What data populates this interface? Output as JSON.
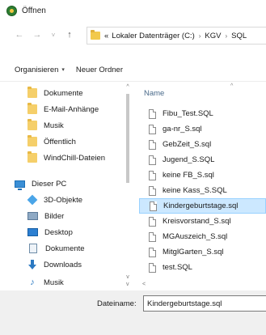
{
  "window": {
    "title": "Öffnen"
  },
  "nav": {
    "back": "←",
    "forward": "→",
    "recent": "˅",
    "up": "↑"
  },
  "address": {
    "prefix": "«",
    "segments": [
      "Lokaler Datenträger (C:)",
      "KGV",
      "SQL"
    ],
    "separator": "›"
  },
  "toolbar": {
    "organize_label": "Organisieren",
    "organize_caret": "▾",
    "new_folder_label": "Neuer Ordner"
  },
  "sidebar": {
    "items": [
      {
        "label": "Dokumente",
        "icon": "folder-icon"
      },
      {
        "label": "E-Mail-Anhänge",
        "icon": "folder-icon"
      },
      {
        "label": "Musik",
        "icon": "folder-icon"
      },
      {
        "label": "Öffentlich",
        "icon": "folder-icon"
      },
      {
        "label": "WindChill-Dateien",
        "icon": "folder-icon"
      },
      {
        "label": "Dieser PC",
        "icon": "computer-icon"
      },
      {
        "label": "3D-Objekte",
        "icon": "cube-icon"
      },
      {
        "label": "Bilder",
        "icon": "pictures-icon"
      },
      {
        "label": "Desktop",
        "icon": "desktop-icon"
      },
      {
        "label": "Dokumente",
        "icon": "documents-icon"
      },
      {
        "label": "Downloads",
        "icon": "download-icon"
      },
      {
        "label": "Musik",
        "icon": "music-icon"
      }
    ]
  },
  "filelist": {
    "column_header": "Name",
    "sort_indicator": "^",
    "files": [
      "Fibu_Test.SQL",
      "ga-nr_S.sql",
      "GebZeit_S.sql",
      "Jugend_S.SQL",
      "keine FB_S.sql",
      "keine Kass_S.SQL",
      "Kindergeburtstage.sql",
      "Kreisvorstand_S.sql",
      "MGAuszeich_S.sql",
      "MitglGarten_S.sql",
      "test.SQL"
    ],
    "selected_index": 6
  },
  "scroll": {
    "up": "^",
    "down": "v",
    "left": "<"
  },
  "footer": {
    "filename_label": "Dateiname:",
    "filename_value": "Kindergeburtstage.sql"
  }
}
